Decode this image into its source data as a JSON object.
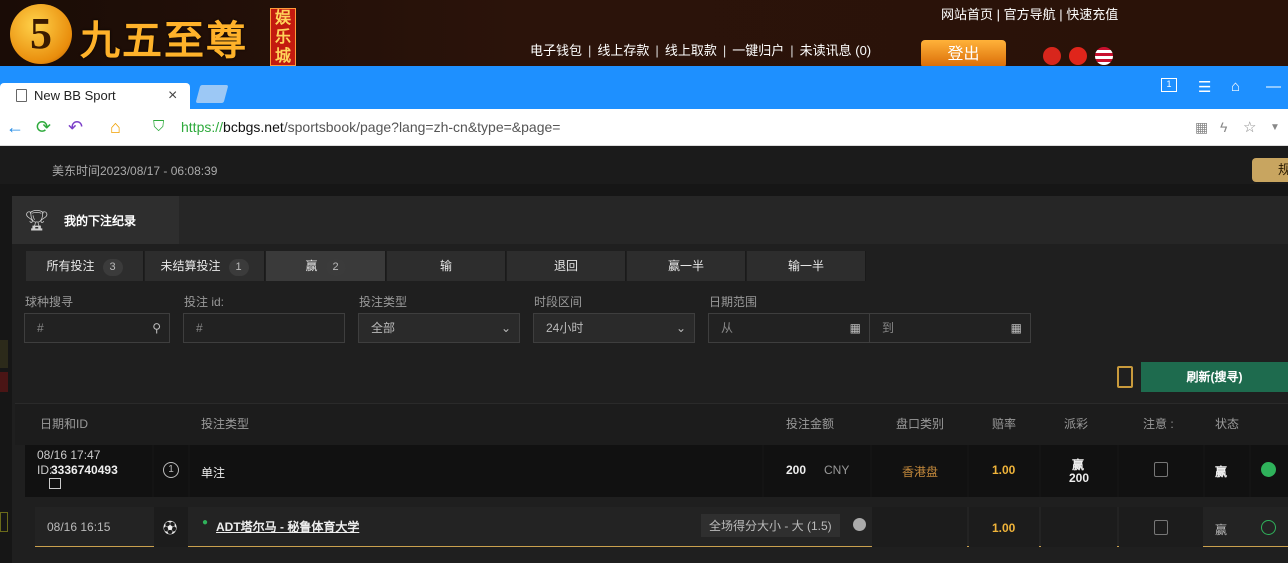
{
  "site": {
    "logo_number": "5",
    "logo_text": "九五至尊",
    "logo_tag": "娱乐城",
    "top_links": "网站首页 | 官方导航 | 快速充值",
    "main_links": [
      "电子钱包",
      "线上存款",
      "线上取款",
      "一键归户",
      "未读讯息 (0)"
    ],
    "logout": "登出"
  },
  "browser": {
    "tab_title": "New BB Sport",
    "tab_close": "×",
    "url_scheme": "https://",
    "url_host": "bcbgs.net",
    "url_path": "/sportsbook/page?lang=zh-cn&type=&page="
  },
  "page": {
    "time_text": "美东时间2023/08/17 - 06:08:39",
    "rules_btn": "规",
    "mybets_title": "我的下注纪录",
    "tabs": [
      {
        "label": "所有投注",
        "count": "3"
      },
      {
        "label": "未结算投注",
        "count": "1"
      },
      {
        "label": "赢",
        "count": "2"
      },
      {
        "label": "输",
        "count": ""
      },
      {
        "label": "退回",
        "count": ""
      },
      {
        "label": "赢一半",
        "count": ""
      },
      {
        "label": "输一半",
        "count": ""
      }
    ],
    "filters": {
      "sport_label": "球种搜寻",
      "sport_placeholder": "#",
      "betid_label": "投注 id:",
      "betid_placeholder": "#",
      "type_label": "投注类型",
      "type_value": "全部",
      "period_label": "时段区间",
      "period_value": "24小时",
      "date_label": "日期范围",
      "date_from": "从",
      "date_to": "到"
    },
    "refresh": "刷新(搜寻)",
    "headers": [
      "日期和ID",
      "投注类型",
      "投注金额",
      "盘口类别",
      "赔率",
      "派彩",
      "注意 :",
      "状态"
    ],
    "bet": {
      "datetime": "08/16 17:47",
      "id_prefix": "ID:",
      "id": "3336740493",
      "leg_count": "1",
      "type": "单注",
      "amount": "200",
      "currency": "CNY",
      "odds_type": "香港盘",
      "odds": "1.00",
      "payout_label": "赢",
      "payout": "200",
      "status": "赢"
    },
    "leg": {
      "datetime": "08/16 16:15",
      "match": "ADT塔尔马 - 秘鲁体育大学",
      "market": "全场得分大小 - 大 (1.5)",
      "odds": "1.00",
      "status": "赢"
    }
  }
}
